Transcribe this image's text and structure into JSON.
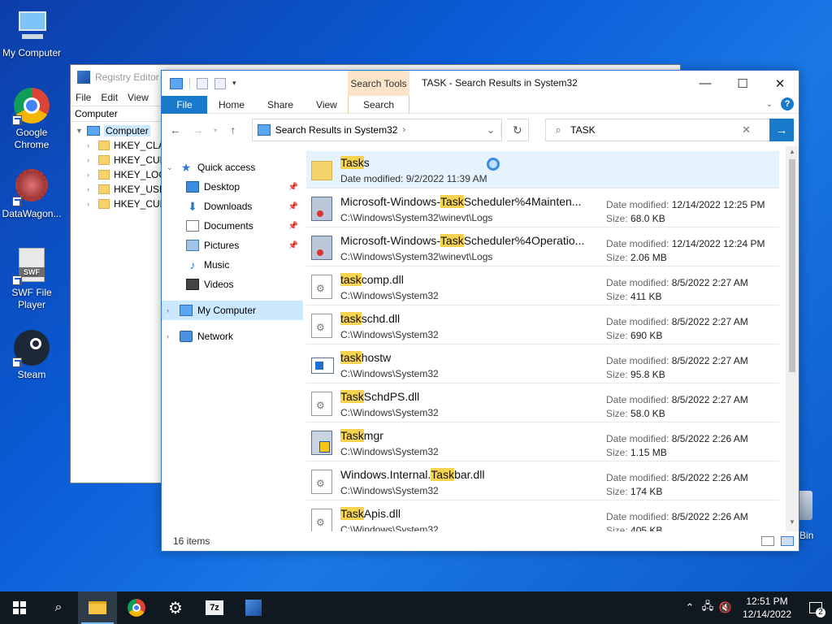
{
  "desktop": {
    "icons": [
      {
        "label": "My Computer"
      },
      {
        "label": "Google Chrome"
      },
      {
        "label": "DataWagon..."
      },
      {
        "label": "SWF File Player"
      },
      {
        "label": "Steam"
      }
    ],
    "recycle_label": "Bin"
  },
  "regedit": {
    "title": "Registry Editor",
    "menu": [
      "File",
      "Edit",
      "View"
    ],
    "address": "Computer",
    "tree": {
      "root": "Computer",
      "keys": [
        "HKEY_CLA",
        "HKEY_CUF",
        "HKEY_LOC",
        "HKEY_USE",
        "HKEY_CUF"
      ]
    }
  },
  "explorer": {
    "title": "TASK - Search Results in System32",
    "search_tools_label": "Search Tools",
    "ribbon_tabs": {
      "file": "File",
      "home": "Home",
      "share": "Share",
      "view": "View",
      "search": "Search"
    },
    "address": {
      "location": "Search Results in System32"
    },
    "search": {
      "query": "TASK"
    },
    "nav": {
      "quick_access": "Quick access",
      "items": [
        "Desktop",
        "Downloads",
        "Documents",
        "Pictures",
        "Music",
        "Videos"
      ],
      "my_computer": "My Computer",
      "network": "Network"
    },
    "results": [
      {
        "pre": "",
        "hl": "Task",
        "post": "s",
        "path": "Date modified: 9/2/2022 11:39 AM",
        "modified": "",
        "size": "",
        "icon": "folder"
      },
      {
        "pre": "Microsoft-Windows-",
        "hl": "Task",
        "post": "Scheduler%4Mainten...",
        "path": "C:\\Windows\\System32\\winevt\\Logs",
        "modified": "12/14/2022 12:25 PM",
        "size": "68.0 KB",
        "icon": "log"
      },
      {
        "pre": "Microsoft-Windows-",
        "hl": "Task",
        "post": "Scheduler%4Operatio...",
        "path": "C:\\Windows\\System32\\winevt\\Logs",
        "modified": "12/14/2022 12:24 PM",
        "size": "2.06 MB",
        "icon": "log"
      },
      {
        "pre": "",
        "hl": "task",
        "post": "comp.dll",
        "path": "C:\\Windows\\System32",
        "modified": "8/5/2022 2:27 AM",
        "size": "411 KB",
        "icon": "dll"
      },
      {
        "pre": "",
        "hl": "task",
        "post": "schd.dll",
        "path": "C:\\Windows\\System32",
        "modified": "8/5/2022 2:27 AM",
        "size": "690 KB",
        "icon": "dll"
      },
      {
        "pre": "",
        "hl": "task",
        "post": "hostw",
        "path": "C:\\Windows\\System32",
        "modified": "8/5/2022 2:27 AM",
        "size": "95.8 KB",
        "icon": "exe"
      },
      {
        "pre": "",
        "hl": "Task",
        "post": "SchdPS.dll",
        "path": "C:\\Windows\\System32",
        "modified": "8/5/2022 2:27 AM",
        "size": "58.0 KB",
        "icon": "dll"
      },
      {
        "pre": "",
        "hl": "Task",
        "post": "mgr",
        "path": "C:\\Windows\\System32",
        "modified": "8/5/2022 2:26 AM",
        "size": "1.15 MB",
        "icon": "mgr"
      },
      {
        "pre": "Windows.Internal.",
        "hl": "Task",
        "post": "bar.dll",
        "path": "C:\\Windows\\System32",
        "modified": "8/5/2022 2:26 AM",
        "size": "174 KB",
        "icon": "dll"
      },
      {
        "pre": "",
        "hl": "Task",
        "post": "Apis.dll",
        "path": "C:\\Windows\\System32",
        "modified": "8/5/2022 2:26 AM",
        "size": "405 KB",
        "icon": "dll"
      }
    ],
    "labels": {
      "date_modified": "Date modified:",
      "size": "Size:"
    },
    "status": "16 items"
  },
  "taskbar": {
    "time": "12:51 PM",
    "date": "12/14/2022",
    "notifications": "2"
  }
}
